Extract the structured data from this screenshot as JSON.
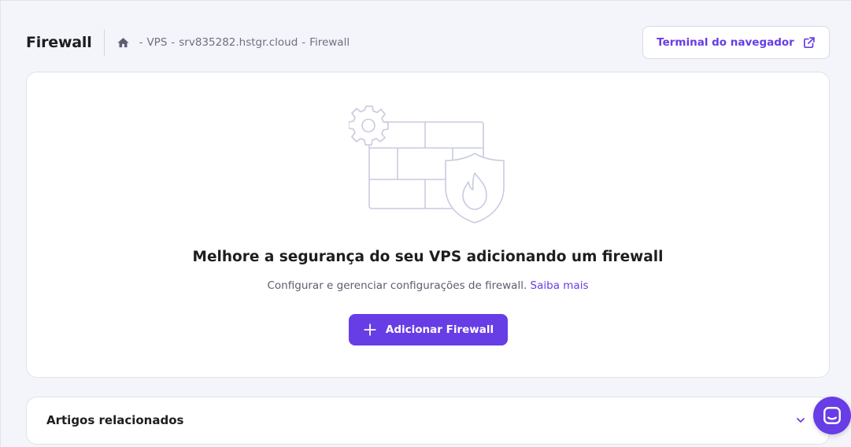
{
  "header": {
    "title": "Firewall",
    "breadcrumb": [
      "VPS",
      "srv835282.hstgr.cloud",
      "Firewall"
    ],
    "separator": "-",
    "terminal_button": "Terminal do navegador"
  },
  "empty_state": {
    "heading": "Melhore a segurança do seu VPS adicionando um firewall",
    "subtitle": "Configurar e gerenciar configurações de firewall.",
    "learn_more": "Saiba mais",
    "add_button": "Adicionar Firewall"
  },
  "related": {
    "title": "Artigos relacionados"
  },
  "icons": {
    "home": "home-icon",
    "external": "external-link-icon",
    "plus": "plus-icon",
    "chevron": "chevron-down-icon",
    "chat": "chat-icon",
    "illustration": "firewall-shield-illustration"
  },
  "colors": {
    "accent": "#673de6",
    "background": "#f4f4fb",
    "text": "#1d1e20",
    "muted": "#6d7081"
  }
}
